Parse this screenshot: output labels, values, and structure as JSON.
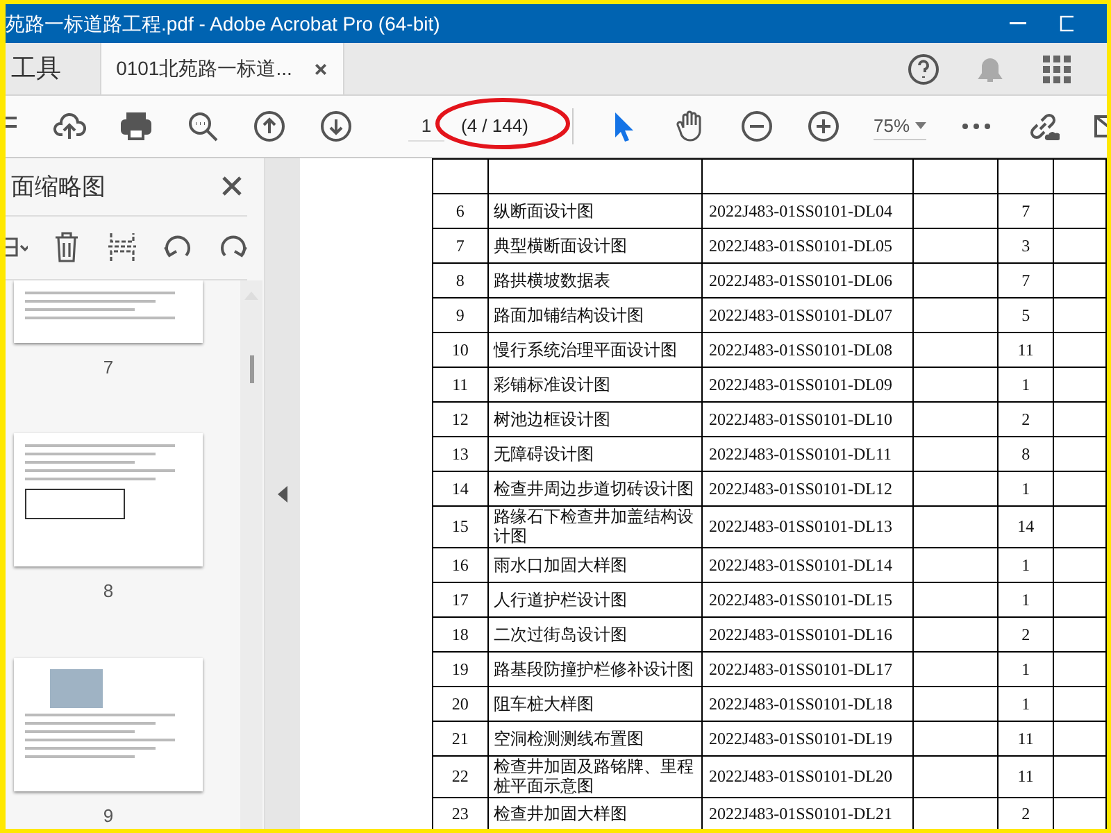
{
  "window": {
    "title": "苑路一标道路工程.pdf - Adobe Acrobat Pro (64-bit)"
  },
  "tabs": [
    {
      "label": "工具",
      "selected": false
    },
    {
      "label": "0101北苑路一标道...",
      "selected": true
    }
  ],
  "toolbar": {
    "tools": [
      {
        "kind": "select",
        "selected": true
      },
      {
        "kind": "hand",
        "selected": false
      }
    ],
    "page_field": {
      "value": "1"
    },
    "page_count": "(4 / 144)",
    "zoom": "75%"
  },
  "sidebar": {
    "title": "面缩略图",
    "thumbnails": [
      {
        "label": "7",
        "kind": "text"
      },
      {
        "label": "8",
        "kind": "table"
      },
      {
        "label": "9",
        "kind": "photo"
      }
    ]
  },
  "table": {
    "rows": [
      {
        "column_1": "6",
        "column_2": "纵断面设计图",
        "column_3": "2022J483-01SS0101-DL04",
        "column_5": "7"
      },
      {
        "column_1": "7",
        "column_2": "典型横断面设计图",
        "column_3": "2022J483-01SS0101-DL05",
        "column_5": "3"
      },
      {
        "column_1": "8",
        "column_2": "路拱横坡数据表",
        "column_3": "2022J483-01SS0101-DL06",
        "column_5": "7"
      },
      {
        "column_1": "9",
        "column_2": "路面加铺结构设计图",
        "column_3": "2022J483-01SS0101-DL07",
        "column_5": "5"
      },
      {
        "column_1": "10",
        "column_2": "慢行系统治理平面设计图",
        "column_3": "2022J483-01SS0101-DL08",
        "column_5": "11"
      },
      {
        "column_1": "11",
        "column_2": "彩铺标准设计图",
        "column_3": "2022J483-01SS0101-DL09",
        "column_5": "1"
      },
      {
        "column_1": "12",
        "column_2": "树池边框设计图",
        "column_3": "2022J483-01SS0101-DL10",
        "column_5": "2"
      },
      {
        "column_1": "13",
        "column_2": "无障碍设计图",
        "column_3": "2022J483-01SS0101-DL11",
        "column_5": "8"
      },
      {
        "column_1": "14",
        "column_2": "检查井周边步道切砖设计图",
        "column_3": "2022J483-01SS0101-DL12",
        "column_5": "1"
      },
      {
        "column_1": "15",
        "column_2": "路缘石下检查井加盖结构设计图",
        "column_3": "2022J483-01SS0101-DL13",
        "column_5": "14"
      },
      {
        "column_1": "16",
        "column_2": "雨水口加固大样图",
        "column_3": "2022J483-01SS0101-DL14",
        "column_5": "1"
      },
      {
        "column_1": "17",
        "column_2": "人行道护栏设计图",
        "column_3": "2022J483-01SS0101-DL15",
        "column_5": "1"
      },
      {
        "column_1": "18",
        "column_2": "二次过街岛设计图",
        "column_3": "2022J483-01SS0101-DL16",
        "column_5": "2"
      },
      {
        "column_1": "19",
        "column_2": "路基段防撞护栏修补设计图",
        "column_3": "2022J483-01SS0101-DL17",
        "column_5": "1"
      },
      {
        "column_1": "20",
        "column_2": "阻车桩大样图",
        "column_3": "2022J483-01SS0101-DL18",
        "column_5": "1"
      },
      {
        "column_1": "21",
        "column_2": "空洞检测测线布置图",
        "column_3": "2022J483-01SS0101-DL19",
        "column_5": "11"
      },
      {
        "column_1": "22",
        "column_2": "检查井加固及路铭牌、里程桩平面示意图",
        "column_3": "2022J483-01SS0101-DL20",
        "column_5": "11"
      },
      {
        "column_1": "23",
        "column_2": "检查井加固大样图",
        "column_3": "2022J483-01SS0101-DL21",
        "column_5": "2"
      }
    ]
  }
}
